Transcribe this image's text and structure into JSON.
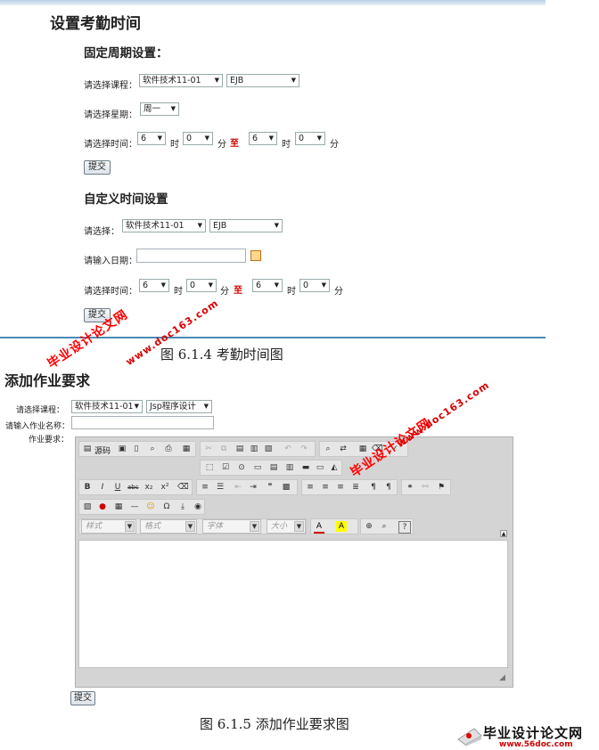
{
  "top": {
    "title": "设置考勤时间",
    "fixed": {
      "heading": "固定周期设置：",
      "course_label": "请选择课程：",
      "course_value": "软件技术11-01",
      "subject_value": "EJB",
      "week_label": "请选择星期：",
      "week_value": "周一",
      "time_label": "请选择时间：",
      "start_hour": "6",
      "hour_unit": "时",
      "start_min": "0",
      "min_unit": "分",
      "to": "至",
      "end_hour": "6",
      "end_min": "0",
      "submit": "提交"
    },
    "custom": {
      "heading": "自定义时间设置",
      "select_label": "请选择：",
      "course_value": "软件技术11-01",
      "subject_value": "EJB",
      "date_label": "请输入日期：",
      "time_label": "请选择时间：",
      "start_hour": "6",
      "hour_unit": "时",
      "start_min": "0",
      "min_unit": "分",
      "to": "至",
      "end_hour": "6",
      "end_min": "0",
      "submit": "提交"
    },
    "caption": "图 6.1.4 考勤时间图"
  },
  "bottom": {
    "title": "添加作业要求",
    "course_label": "请选择课程：",
    "course_value": "软件技术11-01",
    "subject_value": "Jsp程序设计",
    "name_label": "请输入作业名称：",
    "req_label": "作业要求：",
    "toolbar": {
      "source": "源码",
      "style": "样式",
      "format": "格式",
      "font": "字体",
      "size": "大小"
    },
    "submit": "提交",
    "caption": "图 6.1.5 添加作业要求图"
  },
  "watermarks": {
    "site_cn": "毕业设计论文网",
    "site_url": "www.doc163.com",
    "footer_cn": "毕业设计论文网",
    "footer_url": "www.56doc.com"
  }
}
